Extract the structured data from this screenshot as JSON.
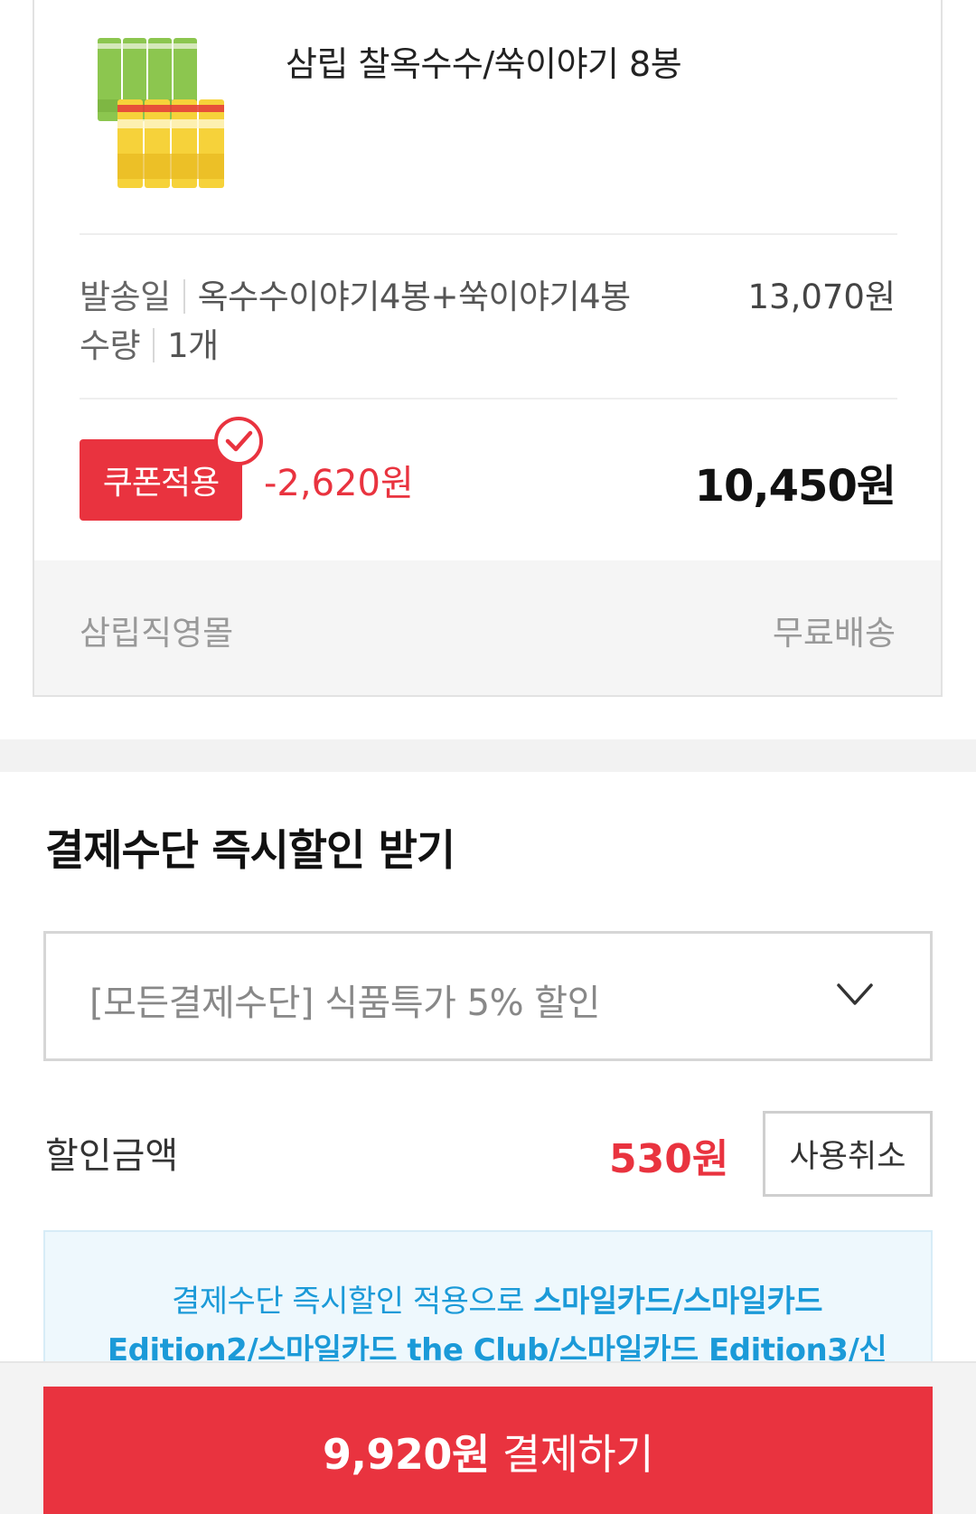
{
  "product": {
    "name": "삼립 찰옥수수/쑥이야기 8봉",
    "image_icon": "product-thumbnail"
  },
  "option": {
    "ship_label": "발송일",
    "option_value": "옥수수이야기4봉+쑥이야기4봉",
    "price": "13,070원",
    "qty_label": "수량",
    "qty_value": "1개"
  },
  "coupon": {
    "button_label": "쿠폰적용",
    "discount": "-2,620원",
    "final_price": "10,450원"
  },
  "seller": {
    "name": "삼립직영몰",
    "shipping": "무료배송"
  },
  "payment": {
    "title": "결제수단 즉시할인 받기",
    "selected_option": "[모든결제수단] 식품특가 5% 할인",
    "discount_label": "할인금액",
    "discount_amount": "530원",
    "cancel_label": "사용취소",
    "info_prefix": "결제수단 즉시할인 적용으로 ",
    "info_cards_line1": "스마일카드/스마일카드",
    "info_cards_line2": "Edition2/스마일카드 the Club/스마일카드 Edition3/신"
  },
  "checkout": {
    "amount": "9,920원",
    "label": "결제하기"
  },
  "colors": {
    "accent_red": "#e9333f",
    "info_blue": "#1b9ad8"
  }
}
